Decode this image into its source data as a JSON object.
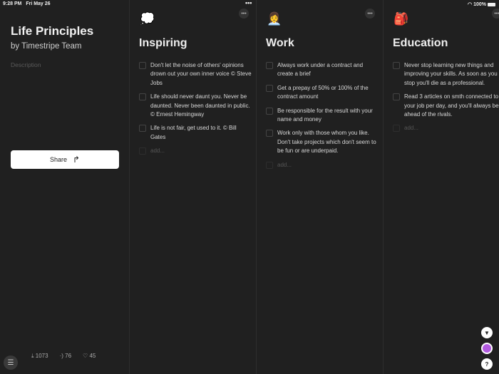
{
  "status": {
    "time": "9:28 PM",
    "date": "Fri May 26",
    "battery": "100%"
  },
  "board": {
    "title": "Life Principles",
    "author": "by Timestripe Team",
    "description_placeholder": "Description",
    "share_label": "Share",
    "stats": {
      "downloads": "1073",
      "shares": "76",
      "likes": "45"
    }
  },
  "columns": [
    {
      "emoji": "💭",
      "title": "Inspiring",
      "tasks": [
        "Don't let the noise of others' opinions drown out your own inner voice © Steve Jobs",
        "Life should never daunt you. Never be daunted. Never been daunted in public. © Ernest Hemingway",
        "Life is not fair, get used to it. © Bill Gates"
      ],
      "add": "add..."
    },
    {
      "emoji": "👩‍💼",
      "title": "Work",
      "tasks": [
        "Always work under a contract and create a brief",
        "Get a prepay of 50% or 100% of the contract amount",
        "Be responsible for the result with your name and money",
        "Work only with those whom you like. Don't take projects which don't seem to be fun or are underpaid."
      ],
      "add": "add..."
    },
    {
      "emoji": "🎒",
      "title": "Education",
      "tasks": [
        "Never stop learning new things and improving your skills. As soon as you stop you'll die as a professional.",
        "Read 3 articles on smth connected to your job per day, and you'll always be ahead of the rivals."
      ],
      "add": "add..."
    }
  ],
  "accent": "#b25ae0"
}
